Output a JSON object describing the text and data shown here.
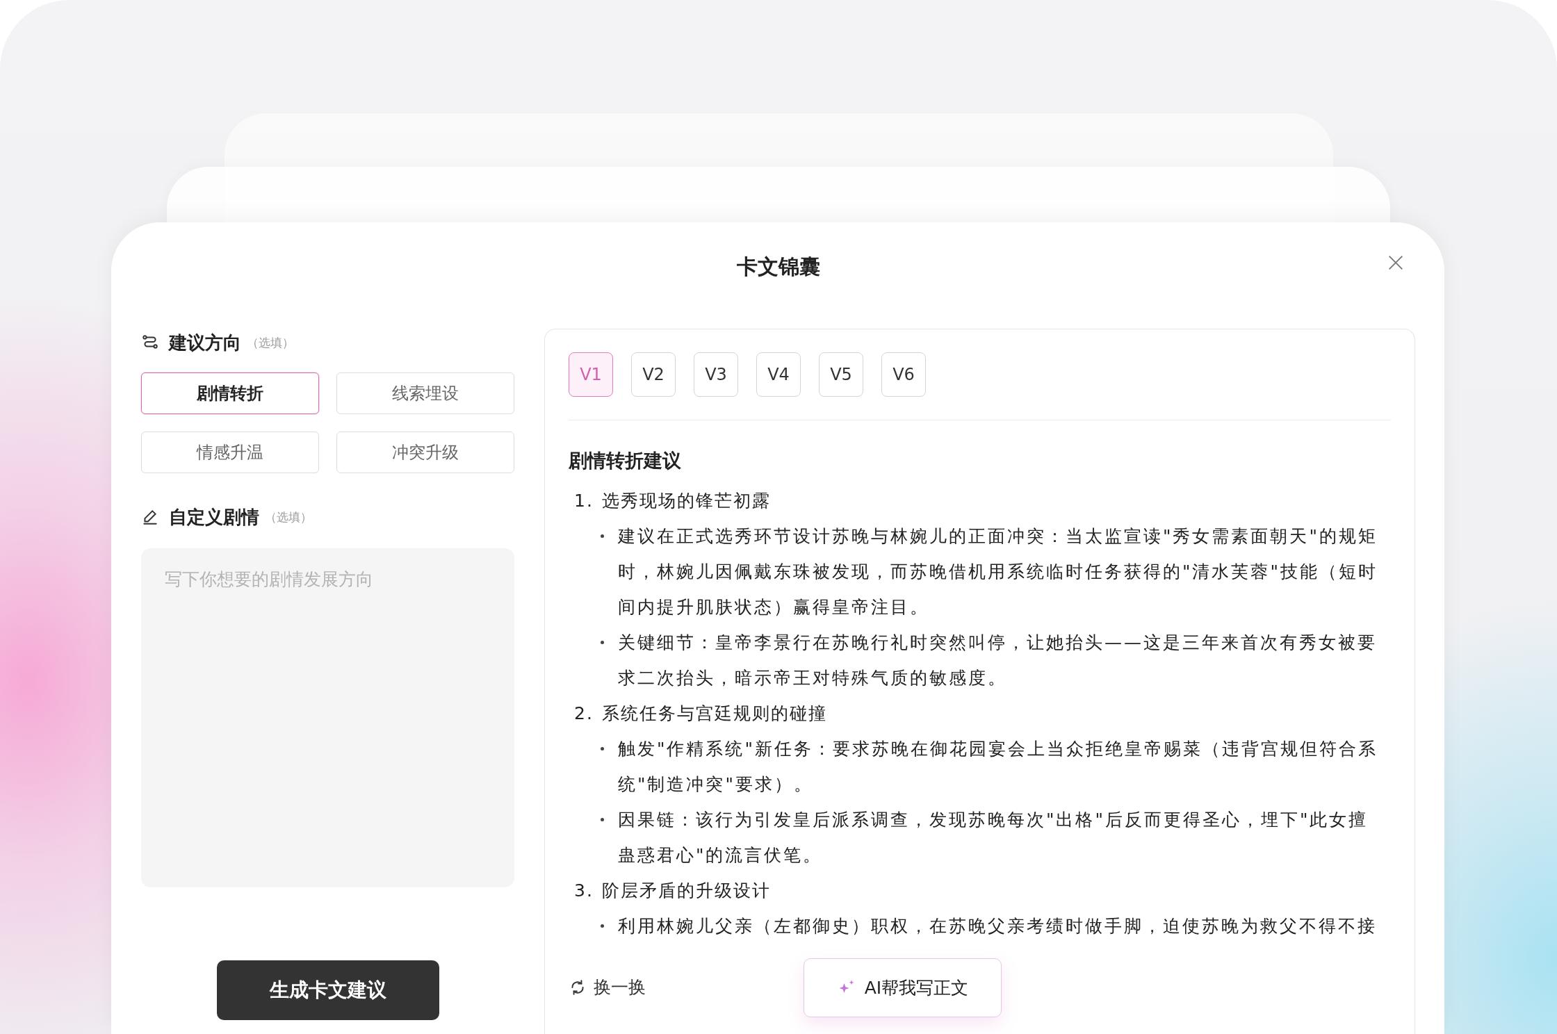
{
  "dialog": {
    "title": "卡文锦囊"
  },
  "direction": {
    "label": "建议方向",
    "hint": "（选填）",
    "options": [
      {
        "label": "剧情转折",
        "selected": true
      },
      {
        "label": "线索埋设",
        "selected": false
      },
      {
        "label": "情感升温",
        "selected": false
      },
      {
        "label": "冲突升级",
        "selected": false
      }
    ]
  },
  "custom": {
    "label": "自定义剧情",
    "hint": "（选填）",
    "placeholder": "写下你想要的剧情发展方向"
  },
  "generate_button": "生成卡文建议",
  "versions": [
    {
      "label": "V1",
      "selected": true
    },
    {
      "label": "V2",
      "selected": false
    },
    {
      "label": "V3",
      "selected": false
    },
    {
      "label": "V4",
      "selected": false
    },
    {
      "label": "V5",
      "selected": false
    },
    {
      "label": "V6",
      "selected": false
    }
  ],
  "suggestion": {
    "heading": "剧情转折建议",
    "items": [
      {
        "number": "1.",
        "title": "选秀现场的锋芒初露",
        "bullets": [
          "建议在正式选秀环节设计苏晚与林婉儿的正面冲突：当太监宣读\"秀女需素面朝天\"的规矩时，林婉儿因佩戴东珠被发现，而苏晚借机用系统临时任务获得的\"清水芙蓉\"技能（短时间内提升肌肤状态）赢得皇帝注目。",
          "关键细节：皇帝李景行在苏晚行礼时突然叫停，让她抬头——这是三年来首次有秀女被要求二次抬头，暗示帝王对特殊气质的敏感度。"
        ]
      },
      {
        "number": "2.",
        "title": "系统任务与宫廷规则的碰撞",
        "bullets": [
          "触发\"作精系统\"新任务：要求苏晚在御花园宴会上当众拒绝皇帝赐菜（违背宫规但符合系统\"制造冲突\"要求）。",
          "因果链：该行为引发皇后派系调查，发现苏晚每次\"出格\"后反而更得圣心，埋下\"此女擅蛊惑君心\"的流言伏笔。"
        ]
      },
      {
        "number": "3.",
        "title": "阶层矛盾的升级设计",
        "bullets": [
          "利用林婉儿父亲（左都御史）职权，在苏晚父亲考绩时做手脚，迫使苏晚为救父不得不接"
        ]
      }
    ]
  },
  "refresh_button": "换一换",
  "ai_button": "AI帮我写正文"
}
